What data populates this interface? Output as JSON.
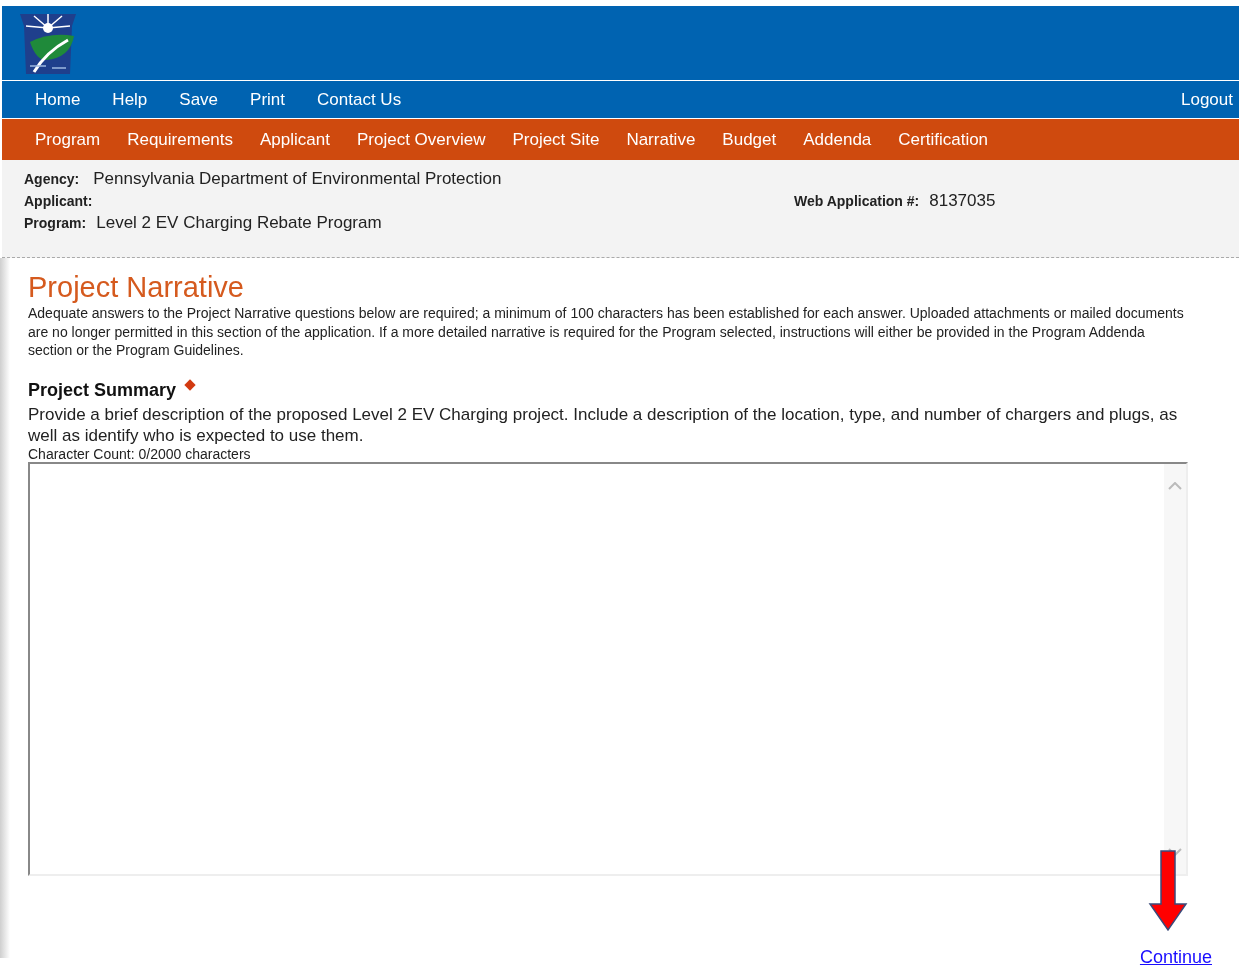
{
  "top_nav": {
    "links": [
      "Home",
      "Help",
      "Save",
      "Print",
      "Contact Us"
    ],
    "logout": "Logout"
  },
  "section_nav": [
    "Program",
    "Requirements",
    "Applicant",
    "Project Overview",
    "Project Site",
    "Narrative",
    "Budget",
    "Addenda",
    "Certification"
  ],
  "info": {
    "agency_label": "Agency:",
    "agency": "Pennsylvania Department of Environmental Protection",
    "applicant_label": "Applicant:",
    "program_label": "Program:",
    "program": "Level 2 EV Charging Rebate Program",
    "web_app_label": "Web Application #:",
    "web_app": "8137035"
  },
  "page": {
    "title": "Project Narrative",
    "intro": "Adequate answers to the Project Narrative questions below are required; a minimum of 100 characters has been established for each answer. Uploaded attachments or mailed documents are no longer permitted in this section of the application. If a more detailed narrative is required for the Program selected, instructions will either be provided in the Program Addenda section or the Program Guidelines."
  },
  "question": {
    "title": "Project Summary",
    "required": true,
    "prompt": "Provide a brief description of the proposed Level 2 EV Charging project. Include a description of the location, type, and number of chargers and plugs, as well as identify who is expected to use them.",
    "count": "Character Count: 0/2000 characters"
  },
  "continue_link": "Continue"
}
